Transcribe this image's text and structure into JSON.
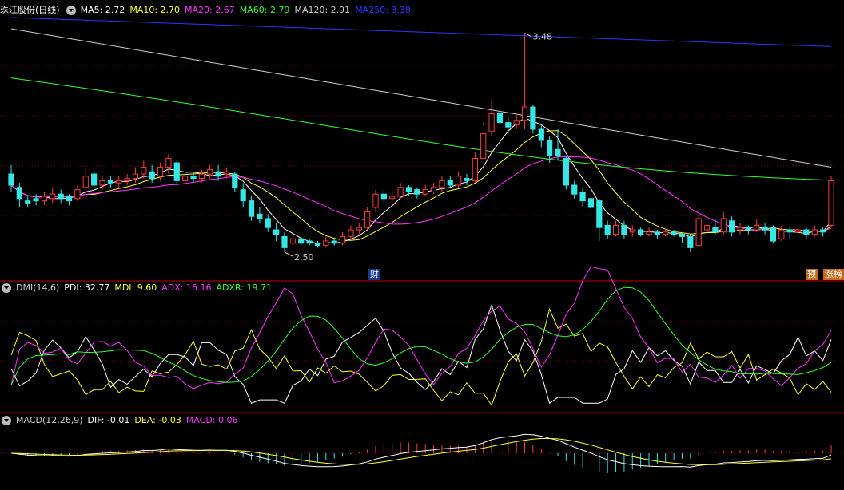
{
  "header": {
    "stock_name": "珠江股份(日线)",
    "ma_items": [
      {
        "label": "MA5: 2.72",
        "color": "#ffffff"
      },
      {
        "label": "MA10: 2.70",
        "color": "#ffff33"
      },
      {
        "label": "MA20: 2.67",
        "color": "#ff33ff"
      },
      {
        "label": "MA60: 2.79",
        "color": "#33ff33"
      },
      {
        "label": "MA120: 2.91",
        "color": "#cccccc"
      },
      {
        "label": "MA250: 3.38",
        "color": "#3333ff"
      }
    ]
  },
  "dmi_header": {
    "name": "DMI(14,6)",
    "items": [
      {
        "label": "PDI: 32.77",
        "color": "#ffffff"
      },
      {
        "label": "MDI: 9.60",
        "color": "#ffff33"
      },
      {
        "label": "ADX: 16.16",
        "color": "#ff33ff"
      },
      {
        "label": "ADXR: 19.71",
        "color": "#33ff33"
      }
    ]
  },
  "macd_header": {
    "name": "MACD(12,26,9)",
    "items": [
      {
        "label": "DIF: -0.01",
        "color": "#ffffff"
      },
      {
        "label": "DEA: -0.03",
        "color": "#ffff33"
      },
      {
        "label": "MACD: 0.06",
        "color": "#ff33ff"
      }
    ]
  },
  "annotations": {
    "high_label": "3.48",
    "low_label": "2.50",
    "finance_marker": "财",
    "forecast_marker": "预",
    "limit_up_marker": "涨榜"
  },
  "colors": {
    "up": "#ff3a3a",
    "down": "#35e6e6",
    "grid": "#7a0000",
    "ma5": "#ffffff",
    "ma10": "#ffff33",
    "ma20": "#ff33ff",
    "ma60": "#33ff33",
    "ma120": "#cccccc",
    "ma250": "#3333ff"
  },
  "chart_data": {
    "type": "candlestick",
    "price_range": [
      2.45,
      3.55
    ],
    "candles": [
      [
        2.85,
        2.8,
        2.89,
        2.77
      ],
      [
        2.79,
        2.74,
        2.81,
        2.7
      ],
      [
        2.73,
        2.72,
        2.75,
        2.7
      ],
      [
        2.74,
        2.73,
        2.76,
        2.71
      ],
      [
        2.73,
        2.75,
        2.77,
        2.71
      ],
      [
        2.74,
        2.76,
        2.79,
        2.72
      ],
      [
        2.76,
        2.74,
        2.78,
        2.72
      ],
      [
        2.75,
        2.73,
        2.76,
        2.71
      ],
      [
        2.74,
        2.78,
        2.8,
        2.73
      ],
      [
        2.79,
        2.84,
        2.88,
        2.76
      ],
      [
        2.85,
        2.8,
        2.87,
        2.78
      ],
      [
        2.8,
        2.82,
        2.84,
        2.78
      ],
      [
        2.82,
        2.81,
        2.84,
        2.79
      ],
      [
        2.81,
        2.82,
        2.84,
        2.79
      ],
      [
        2.82,
        2.83,
        2.85,
        2.8
      ],
      [
        2.83,
        2.85,
        2.88,
        2.81
      ],
      [
        2.85,
        2.88,
        2.91,
        2.83
      ],
      [
        2.86,
        2.83,
        2.89,
        2.81
      ],
      [
        2.84,
        2.88,
        2.9,
        2.82
      ],
      [
        2.88,
        2.92,
        2.94,
        2.85
      ],
      [
        2.9,
        2.82,
        2.91,
        2.8
      ],
      [
        2.82,
        2.84,
        2.86,
        2.8
      ],
      [
        2.84,
        2.83,
        2.86,
        2.81
      ],
      [
        2.83,
        2.85,
        2.87,
        2.81
      ],
      [
        2.85,
        2.87,
        2.89,
        2.83
      ],
      [
        2.86,
        2.84,
        2.89,
        2.82
      ],
      [
        2.85,
        2.86,
        2.88,
        2.83
      ],
      [
        2.85,
        2.79,
        2.86,
        2.77
      ],
      [
        2.78,
        2.73,
        2.81,
        2.7
      ],
      [
        2.73,
        2.66,
        2.75,
        2.64
      ],
      [
        2.67,
        2.65,
        2.7,
        2.63
      ],
      [
        2.65,
        2.61,
        2.67,
        2.59
      ],
      [
        2.6,
        2.58,
        2.63,
        2.55
      ],
      [
        2.57,
        2.52,
        2.59,
        2.5
      ],
      [
        2.54,
        2.56,
        2.58,
        2.53
      ],
      [
        2.56,
        2.54,
        2.57,
        2.53
      ],
      [
        2.55,
        2.54,
        2.56,
        2.53
      ],
      [
        2.54,
        2.53,
        2.55,
        2.52
      ],
      [
        2.53,
        2.55,
        2.57,
        2.52
      ],
      [
        2.55,
        2.54,
        2.56,
        2.53
      ],
      [
        2.54,
        2.57,
        2.59,
        2.53
      ],
      [
        2.57,
        2.6,
        2.62,
        2.56
      ],
      [
        2.6,
        2.61,
        2.63,
        2.58
      ],
      [
        2.61,
        2.68,
        2.7,
        2.6
      ],
      [
        2.7,
        2.76,
        2.78,
        2.68
      ],
      [
        2.76,
        2.74,
        2.78,
        2.72
      ],
      [
        2.74,
        2.75,
        2.77,
        2.73
      ],
      [
        2.75,
        2.79,
        2.81,
        2.74
      ],
      [
        2.79,
        2.77,
        2.8,
        2.75
      ],
      [
        2.78,
        2.76,
        2.79,
        2.74
      ],
      [
        2.76,
        2.78,
        2.8,
        2.75
      ],
      [
        2.77,
        2.79,
        2.81,
        2.76
      ],
      [
        2.79,
        2.82,
        2.84,
        2.77
      ],
      [
        2.82,
        2.8,
        2.84,
        2.79
      ],
      [
        2.8,
        2.84,
        2.86,
        2.79
      ],
      [
        2.83,
        2.82,
        2.85,
        2.8
      ],
      [
        2.82,
        2.92,
        2.95,
        2.81
      ],
      [
        2.92,
        3.03,
        3.08,
        3.07
      ],
      [
        3.04,
        3.12,
        3.18,
        3.02
      ],
      [
        3.12,
        3.08,
        3.16,
        3.06
      ],
      [
        3.08,
        3.06,
        3.1,
        3.03
      ],
      [
        3.07,
        3.09,
        3.12,
        3.05
      ],
      [
        3.09,
        3.15,
        3.48,
        3.05
      ],
      [
        3.15,
        3.05,
        3.16,
        3.03
      ],
      [
        3.05,
        3.0,
        3.07,
        2.97
      ],
      [
        3.0,
        2.93,
        3.02,
        2.9
      ],
      [
        2.96,
        2.93,
        3.05,
        2.91
      ],
      [
        2.92,
        2.8,
        2.93,
        2.78
      ],
      [
        2.8,
        2.76,
        2.82,
        2.74
      ],
      [
        2.77,
        2.73,
        2.79,
        2.7
      ],
      [
        2.74,
        2.7,
        2.76,
        2.67
      ],
      [
        2.73,
        2.61,
        2.74,
        2.55
      ],
      [
        2.62,
        2.58,
        2.64,
        2.56
      ],
      [
        2.58,
        2.62,
        2.64,
        2.57
      ],
      [
        2.62,
        2.58,
        2.64,
        2.56
      ],
      [
        2.59,
        2.6,
        2.62,
        2.57
      ],
      [
        2.6,
        2.58,
        2.61,
        2.57
      ],
      [
        2.58,
        2.59,
        2.61,
        2.57
      ],
      [
        2.59,
        2.58,
        2.6,
        2.56
      ],
      [
        2.58,
        2.59,
        2.6,
        2.57
      ],
      [
        2.59,
        2.58,
        2.6,
        2.57
      ],
      [
        2.58,
        2.57,
        2.59,
        2.54
      ],
      [
        2.57,
        2.52,
        2.58,
        2.5
      ],
      [
        2.53,
        2.65,
        2.67,
        2.52
      ],
      [
        2.6,
        2.62,
        2.64,
        2.58
      ],
      [
        2.61,
        2.59,
        2.65,
        2.58
      ],
      [
        2.59,
        2.65,
        2.68,
        2.58
      ],
      [
        2.64,
        2.59,
        2.66,
        2.57
      ],
      [
        2.6,
        2.61,
        2.63,
        2.58
      ],
      [
        2.61,
        2.6,
        2.62,
        2.58
      ],
      [
        2.6,
        2.62,
        2.65,
        2.59
      ],
      [
        2.61,
        2.6,
        2.63,
        2.58
      ],
      [
        2.61,
        2.55,
        2.62,
        2.54
      ],
      [
        2.56,
        2.6,
        2.62,
        2.55
      ],
      [
        2.6,
        2.59,
        2.61,
        2.56
      ],
      [
        2.59,
        2.6,
        2.62,
        2.58
      ],
      [
        2.6,
        2.58,
        2.61,
        2.56
      ],
      [
        2.58,
        2.6,
        2.62,
        2.57
      ],
      [
        2.6,
        2.59,
        2.61,
        2.57
      ],
      [
        2.62,
        2.82,
        2.84,
        2.61
      ]
    ]
  }
}
